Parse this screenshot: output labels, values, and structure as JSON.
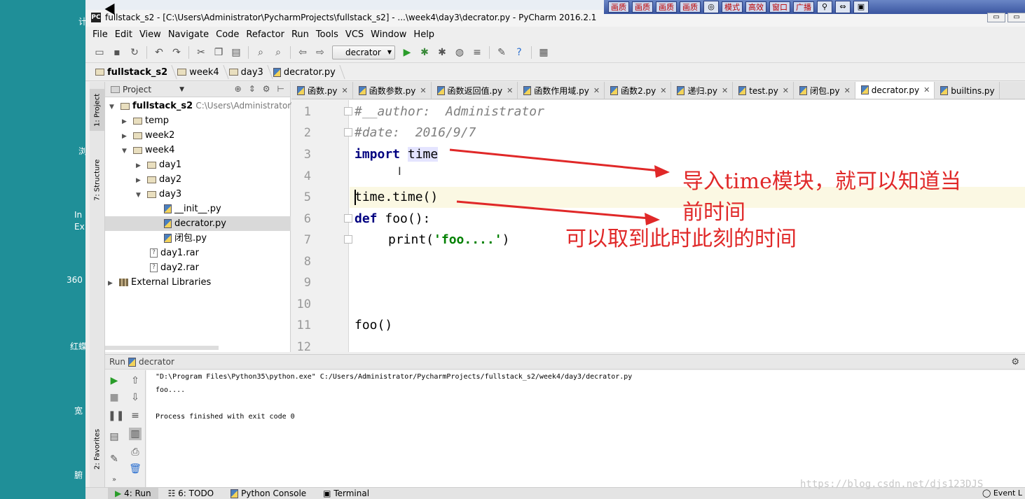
{
  "desktop": {
    "labels": [
      "计",
      "浏",
      "In",
      "Ex",
      "360",
      "红蝶",
      "宽",
      "腑"
    ]
  },
  "window": {
    "icon": "PC",
    "title": "fullstack_s2 - [C:\\Users\\Administrator\\PycharmProjects\\fullstack_s2] - ...\\week4\\day3\\decrator.py - PyCharm 2016.2.1"
  },
  "ext_toolbar": {
    "buttons": [
      "画质",
      "画质",
      "画质",
      "画质",
      "模式",
      "高效",
      "窗口",
      "广播"
    ]
  },
  "menu": [
    "File",
    "Edit",
    "View",
    "Navigate",
    "Code",
    "Refactor",
    "Run",
    "Tools",
    "VCS",
    "Window",
    "Help"
  ],
  "run_config": "decrator",
  "breadcrumb": [
    "fullstack_s2",
    "week4",
    "day3",
    "decrator.py"
  ],
  "project_panel": {
    "header": "Project",
    "root": "fullstack_s2",
    "root_path": "C:\\Users\\Administrator\\F",
    "items": [
      "temp",
      "week2",
      "week4",
      "day1",
      "day2",
      "day3",
      "__init__.py",
      "decrator.py",
      "闭包.py",
      "day1.rar",
      "day2.rar",
      "External Libraries"
    ]
  },
  "side_tabs": [
    "1: Project",
    "7: Structure",
    "2: Favorites"
  ],
  "editor_tabs": [
    "函数.py",
    "函数参数.py",
    "函数返回值.py",
    "函数作用域.py",
    "函数2.py",
    "递归.py",
    "test.py",
    "闭包.py",
    "decrator.py",
    "builtins.py"
  ],
  "code": {
    "line_numbers": [
      "1",
      "2",
      "3",
      "4",
      "5",
      "6",
      "7",
      "8",
      "9",
      "10",
      "11",
      "12"
    ],
    "l1": "#__author:  Administrator",
    "l2": "#date:  2016/9/7",
    "l3_kw": "import",
    "l3_mod": "time",
    "l5": "time.time()",
    "l6_kw": "def",
    "l6_rest": " foo():",
    "l7_a": "print(",
    "l7_str": "'foo....'",
    "l7_b": ")",
    "l11": "foo()"
  },
  "annotations": {
    "a1_line1": "导入time模块，就可以知道当",
    "a1_line2": "前时间",
    "a2": "可以取到此时此刻的时间",
    "color": "#e02828"
  },
  "run_panel": {
    "label": "Run",
    "config": "decrator",
    "console": [
      "\"D:\\Program Files\\Python35\\python.exe\" C:/Users/Administrator/PycharmProjects/fullstack_s2/week4/day3/decrator.py",
      "foo....",
      "",
      "Process finished with exit code 0"
    ]
  },
  "bottom_tabs": [
    "4: Run",
    "6: TODO",
    "Python Console",
    "Terminal"
  ],
  "event_log": "Event L",
  "watermark": "https://blog.csdn.net/djs123DJS"
}
